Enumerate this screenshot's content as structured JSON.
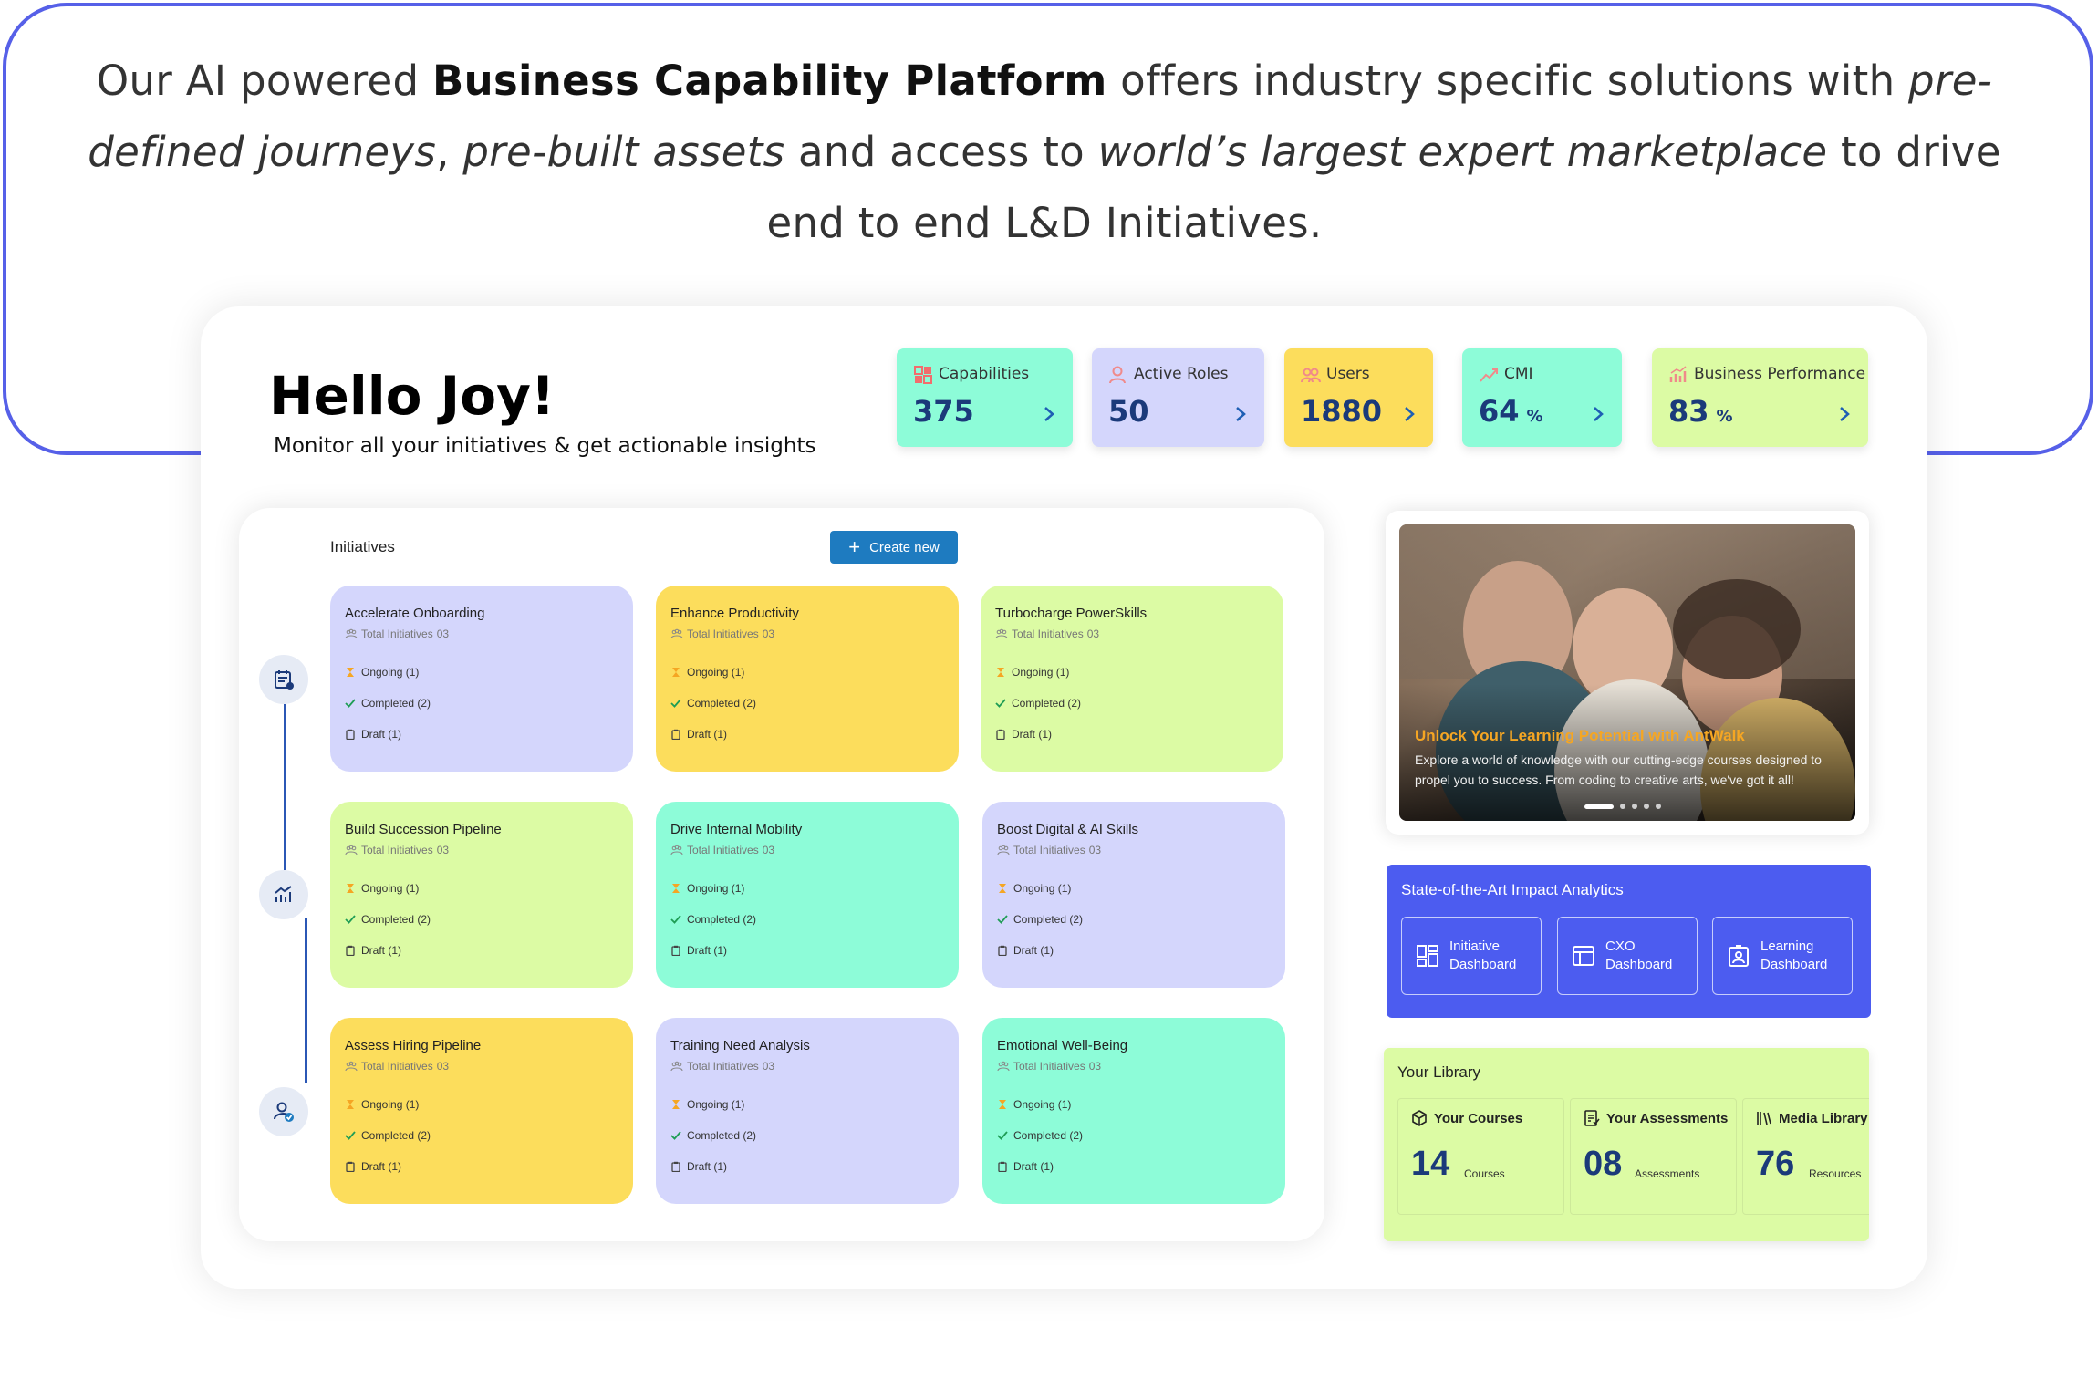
{
  "hero": {
    "p1": "Our AI powered ",
    "b1": "Business Capability Platform",
    "p2": " offers industry specific solutions with ",
    "i1": "pre-defined journeys",
    "p3": ", ",
    "i2": "pre-built assets",
    "p4": " and access to ",
    "i3": "world’s largest expert marketplace",
    "p5": " to drive end to end L&D Initiatives."
  },
  "greeting": {
    "title": "Hello Joy!",
    "subtitle": "Monitor all your initiatives & get actionable insights"
  },
  "stats": [
    {
      "label": "Capabilities",
      "value": "375",
      "unit": "",
      "bg": "#8dfcd8",
      "icon_color": "#f26d6d"
    },
    {
      "label": "Active Roles",
      "value": "50",
      "unit": "",
      "bg": "#d4d6fc",
      "icon_color": "#f08a8a"
    },
    {
      "label": "Users",
      "value": "1880",
      "unit": "",
      "bg": "#fcdd5c",
      "icon_color": "#f08a8a"
    },
    {
      "label": "CMI",
      "value": "64",
      "unit": "%",
      "bg": "#8dfcd8",
      "icon_color": "#f08a8a"
    },
    {
      "label": "Business Performance",
      "value": "83",
      "unit": "%",
      "bg": "#dcfba4",
      "icon_color": "#f08a8a"
    }
  ],
  "initiatives": {
    "title": "Initiatives",
    "create_label": "Create new",
    "total_label": "Total Initiatives",
    "ongoing_label": "Ongoing (1)",
    "completed_label": "Completed (2)",
    "draft_label": "Draft (1)",
    "cards": [
      {
        "title": "Accelerate Onboarding",
        "total": "03",
        "bg": "#d4d6fc"
      },
      {
        "title": "Enhance Productivity",
        "total": "03",
        "bg": "#fcdd5c"
      },
      {
        "title": "Turbocharge PowerSkills",
        "total": "03",
        "bg": "#dcfba4"
      },
      {
        "title": "Build Succession Pipeline",
        "total": "03",
        "bg": "#dcfba4"
      },
      {
        "title": "Drive Internal Mobility",
        "total": "03",
        "bg": "#8dfcd8"
      },
      {
        "title": "Boost Digital & AI Skills",
        "total": "03",
        "bg": "#d4d6fc"
      },
      {
        "title": "Assess Hiring Pipeline",
        "total": "03",
        "bg": "#fcdd5c"
      },
      {
        "title": "Training Need Analysis",
        "total": "03",
        "bg": "#d4d6fc"
      },
      {
        "title": "Emotional Well-Being",
        "total": "03",
        "bg": "#8dfcd8"
      }
    ]
  },
  "banner": {
    "title": "Unlock Your Learning Potential with AntWalk",
    "description": "Explore a world of knowledge with our cutting-edge courses designed to propel you to success. From coding to creative arts, we've got it all!"
  },
  "analytics": {
    "title": "State-of-the-Art Impact Analytics",
    "buttons": [
      {
        "label": "Initiative Dashboard",
        "icon": "dashboard-grid-icon"
      },
      {
        "label": "CXO Dashboard",
        "icon": "browser-window-icon"
      },
      {
        "label": "Learning Dashboard",
        "icon": "id-badge-icon"
      }
    ]
  },
  "library": {
    "title": "Your Library",
    "items": [
      {
        "label": "Your Courses",
        "value": "14",
        "unit": "Courses",
        "icon": "cube-icon"
      },
      {
        "label": "Your Assessments",
        "value": "08",
        "unit": "Assessments",
        "icon": "checklist-icon"
      },
      {
        "label": "Media Library",
        "value": "76",
        "unit": "Resources",
        "icon": "books-icon"
      }
    ]
  },
  "colors": {
    "accent": "#5660e8",
    "primary_button": "#1e7bc0",
    "value_text": "#1b3a7a",
    "analytics_bg": "#4c5cf0",
    "banner_title": "#f5a623"
  }
}
